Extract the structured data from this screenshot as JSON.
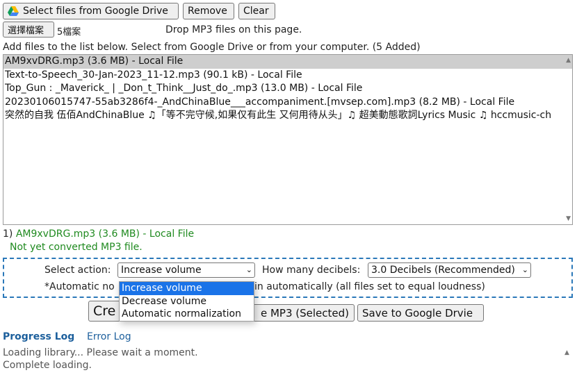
{
  "toolbar": {
    "select_drive": "Select files from Google Drive",
    "remove": "Remove",
    "clear": "Clear"
  },
  "file_input": {
    "choose_button": "選擇檔案",
    "count": "5檔案",
    "drop_hint": "Drop MP3 files on this page."
  },
  "list_header": "Add files to the list below. Select from Google Drive or from your computer. (5 Added)",
  "files": [
    "AM9xvDRG.mp3 (3.6 MB) - Local File",
    "Text-to-Speech_30-Jan-2023_11-12.mp3 (90.1 kB) - Local File",
    "Top_Gun : _Maverick_ | _Don_t_Think__Just_do_.mp3 (13.0 MB) - Local File",
    "20230106015747-55ab3286f4-_AndChinaBlue___accompaniment.[mvsep.com].mp3 (8.2 MB) - Local File",
    "突然的自我 伍佰AndChinaBlue ♫「等不完守候,如果仅有此生 又何用待从头」♫ 超美動態歌詞Lyrics Music ♫ hccmusic-ch"
  ],
  "selected_file": {
    "index": "1)",
    "name": "AM9xvDRG.mp3 (3.6 MB) - Local File",
    "status": "Not yet converted MP3 file."
  },
  "action": {
    "label": "Select action:",
    "value": "Increase volume",
    "decibels_label": "How many decibels:",
    "decibels_value": "3.0 Decibels (Recommended)",
    "note_start": "*Automatic no",
    "note_end": "in automatically (all files set to equal loudness)",
    "options": [
      "Increase volume",
      "Decrease volume",
      "Automatic normalization"
    ]
  },
  "buttons": {
    "create_partial": "Cre",
    "save_mp3_partial": "e MP3 (Selected)",
    "save_drive": "Save to Google Drvie"
  },
  "tabs": {
    "progress": "Progress Log",
    "error": "Error Log"
  },
  "log": [
    "Loading library... Please wait a moment.",
    "Complete loading."
  ],
  "colors": {
    "link": "#1c5f9c",
    "green": "#1f8a1f",
    "dashed_border": "#2a78b9",
    "highlight": "#1a73e8"
  }
}
